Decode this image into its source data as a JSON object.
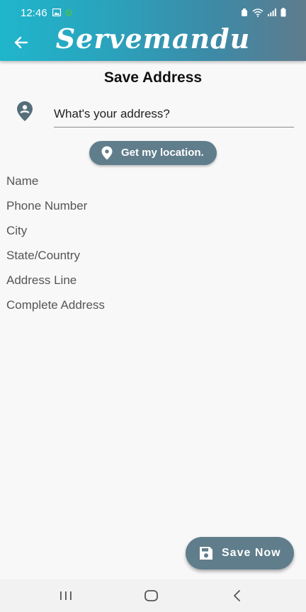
{
  "status_bar": {
    "time": "12:46"
  },
  "header": {
    "title": "Servemandu"
  },
  "page": {
    "title": "Save Address"
  },
  "address": {
    "placeholder": "What's your address?",
    "value": ""
  },
  "location_button": {
    "label": "Get my location."
  },
  "fields": [
    {
      "label": "Name"
    },
    {
      "label": "Phone Number"
    },
    {
      "label": "City"
    },
    {
      "label": "State/Country"
    },
    {
      "label": "Address Line"
    },
    {
      "label": "Complete Address"
    }
  ],
  "save_button": {
    "label": "Save Now"
  },
  "colors": {
    "header_start": "#1fb6cc",
    "header_end": "#5f7b8d",
    "button": "#607d8b",
    "background": "#f8f8f8"
  }
}
